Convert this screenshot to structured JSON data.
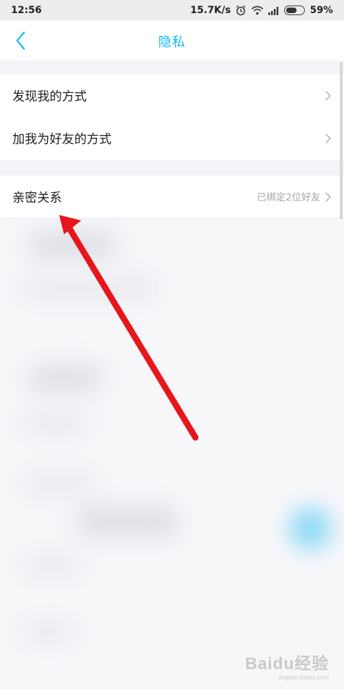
{
  "status_bar": {
    "time": "12:56",
    "network_speed": "15.7K/s",
    "battery_percent": "59%",
    "battery_level": 0.59,
    "icons": [
      "alarm-icon",
      "wifi-icon",
      "signal-icon",
      "battery-icon"
    ]
  },
  "nav": {
    "title": "隐私",
    "back_icon": "chevron-left-icon",
    "accent_color": "#12b7f5"
  },
  "settings": {
    "group1": [
      {
        "label": "发现我的方式"
      },
      {
        "label": "加我为好友的方式"
      }
    ],
    "group2": [
      {
        "label": "亲密关系",
        "value": "已绑定2位好友"
      }
    ]
  },
  "annotation": {
    "arrow_color": "#e8161c"
  },
  "watermark": {
    "brand": "Baidu经验",
    "url": "jingyan.baidu.com"
  }
}
